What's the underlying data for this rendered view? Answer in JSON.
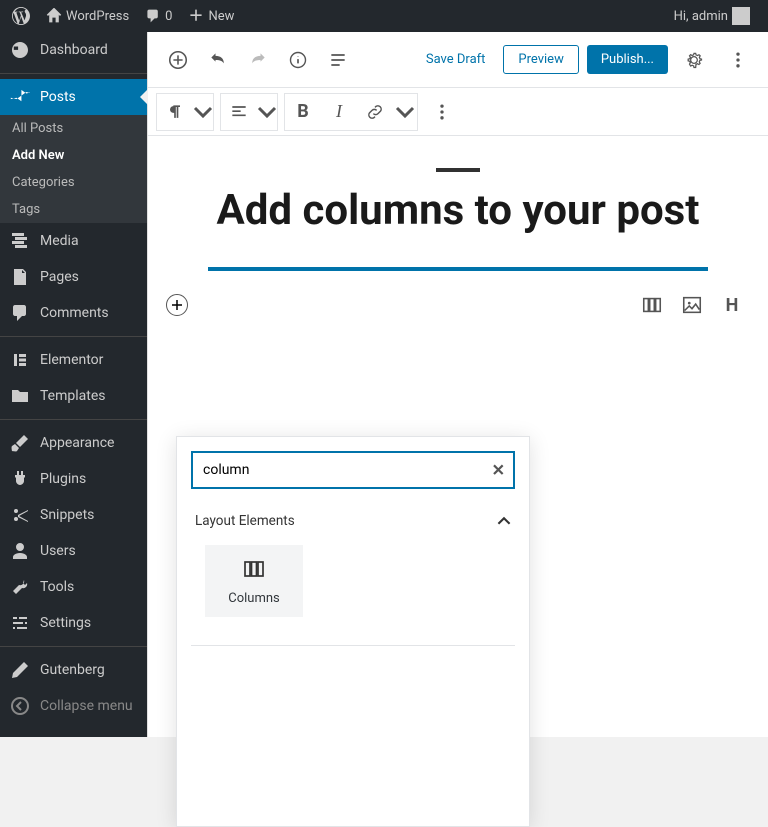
{
  "adminBar": {
    "siteName": "WordPress",
    "comments": "0",
    "new": "New",
    "greeting": "Hi, admin"
  },
  "sidebar": {
    "dashboard": "Dashboard",
    "posts": "Posts",
    "postsSub": {
      "all": "All Posts",
      "add": "Add New",
      "categories": "Categories",
      "tags": "Tags"
    },
    "media": "Media",
    "pages": "Pages",
    "comments": "Comments",
    "elementor": "Elementor",
    "templates": "Templates",
    "appearance": "Appearance",
    "plugins": "Plugins",
    "snippets": "Snippets",
    "users": "Users",
    "tools": "Tools",
    "settings": "Settings",
    "gutenberg": "Gutenberg",
    "collapse": "Collapse menu"
  },
  "editor": {
    "saveDraft": "Save Draft",
    "preview": "Preview",
    "publish": "Publish...",
    "title": "Add columns to your post",
    "inserter": {
      "searchValue": "column",
      "sectionLabel": "Layout Elements",
      "blockColumns": "Columns"
    }
  }
}
